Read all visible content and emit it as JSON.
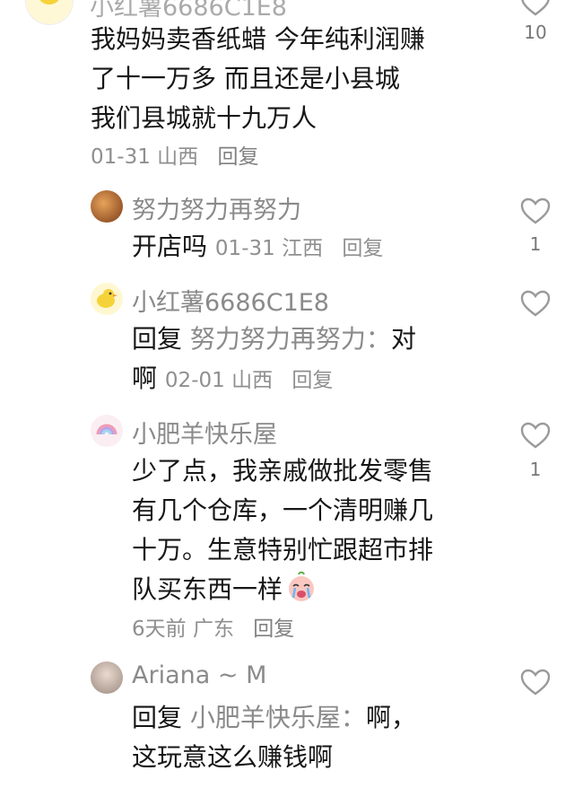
{
  "comments": [
    {
      "lines": [
        "我妈妈卖香纸蜡 今年纯利润赚",
        "了十一万多 而且还是小县城",
        "我们县城就十九万人"
      ],
      "date": "01-31",
      "location": "山西",
      "reply_label": "回复",
      "likes": "10",
      "avatar_icon": "duck-icon"
    },
    {
      "username": "努力努力再努力",
      "text": "开店吗",
      "date": "01-31",
      "location": "江西",
      "reply_label": "回复",
      "likes": "1"
    },
    {
      "username": "小红薯6686C1E8",
      "prefix": "回复",
      "reply_to": "努力努力再努力：",
      "line1_end": "对",
      "line2": "啊",
      "date": "02-01",
      "location": "山西",
      "reply_label": "回复",
      "avatar_icon": "duck-icon"
    },
    {
      "username": "小肥羊快乐屋",
      "lines": [
        "少了点，我亲戚做批发零售",
        "有几个仓库，一个清明赚几",
        "十万。生意特别忙跟超市排",
        "队买东西一样"
      ],
      "emoji": "crying-face-emoji",
      "date": "6天前",
      "location": "广东",
      "reply_label": "回复",
      "likes": "1",
      "avatar_icon": "rainbow-icon"
    },
    {
      "username": "Ariana ~ M",
      "prefix": "回复",
      "reply_to": "小肥羊快乐屋：",
      "line1_end": "啊，",
      "line2": "这玩意这么赚钱啊"
    }
  ],
  "colors": {
    "text": "#161616",
    "meta": "#8f8f8f",
    "name": "#8a8a8a"
  }
}
